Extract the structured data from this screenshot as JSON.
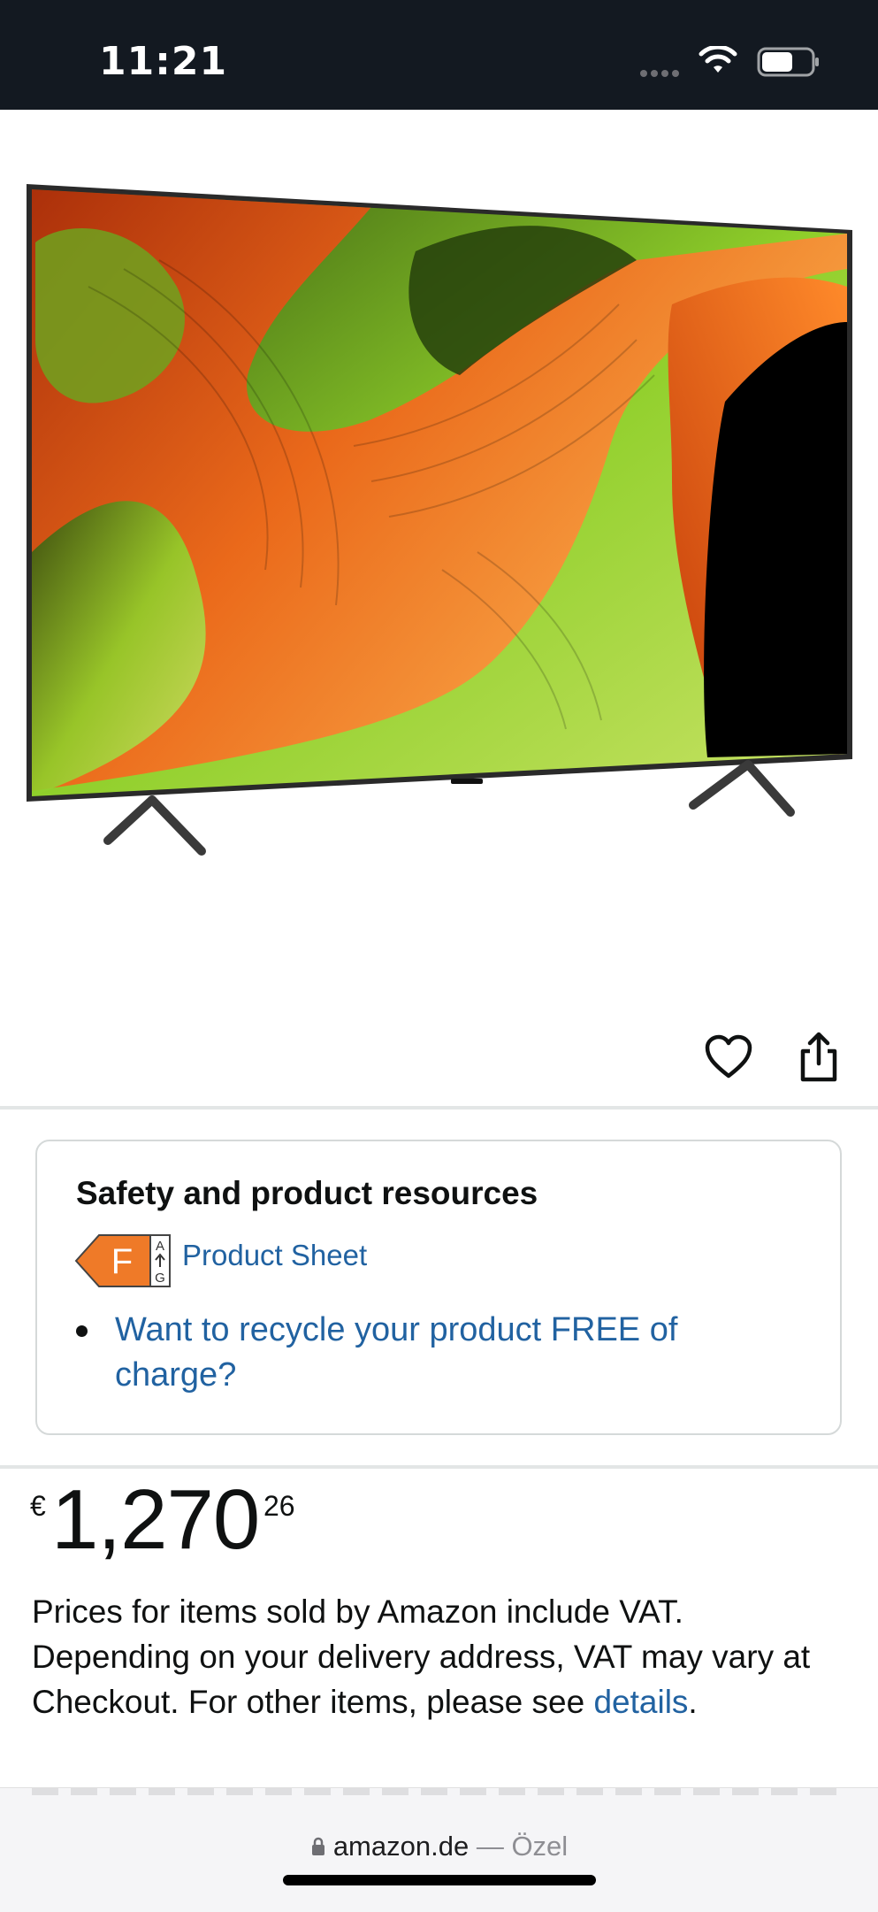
{
  "status_bar": {
    "time": "11:21",
    "icons": [
      "cellular-signal-icon",
      "wifi-icon",
      "battery-icon"
    ]
  },
  "product": {
    "image_alt": "television-product-image",
    "actions": [
      "heart-icon",
      "share-icon"
    ]
  },
  "safety": {
    "title": "Safety and product resources",
    "energy_class": "F",
    "energy_scale_top": "A",
    "energy_scale_bottom": "G",
    "product_sheet_label": "Product Sheet",
    "recycle_label": "Want to recycle your product FREE of charge?"
  },
  "price": {
    "currency_symbol": "€",
    "whole": "1,270",
    "fraction": "26"
  },
  "vat": {
    "text": "Prices for items sold by Amazon include VAT. Depending on your delivery address, VAT may vary at Checkout. For other items, please see ",
    "link_label": "details",
    "suffix": "."
  },
  "browser": {
    "domain": "amazon.de",
    "separator": " — ",
    "mode": "Özel"
  },
  "colors": {
    "header_bg": "#131921",
    "link": "#2162a1",
    "energy_f": "#ef7a28"
  }
}
